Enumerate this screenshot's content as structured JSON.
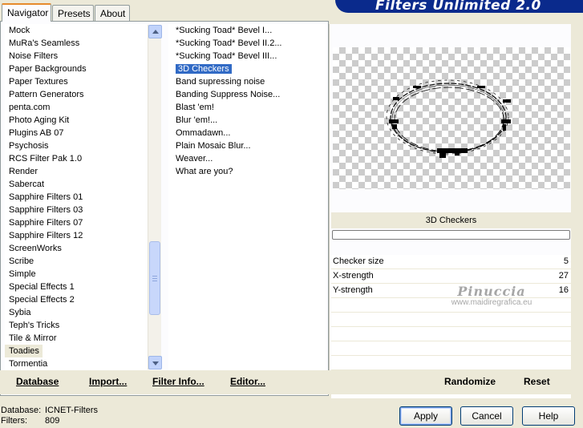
{
  "tabs": [
    "Navigator",
    "Presets",
    "About"
  ],
  "banner_title": "Filters Unlimited 2.0",
  "categories": [
    "Mock",
    "MuRa's Seamless",
    "Noise Filters",
    "Paper Backgrounds",
    "Paper Textures",
    "Pattern Generators",
    "penta.com",
    "Photo Aging Kit",
    "Plugins AB 07",
    "Psychosis",
    "RCS Filter Pak 1.0",
    "Render",
    "Sabercat",
    "Sapphire Filters 01",
    "Sapphire Filters 03",
    "Sapphire Filters 07",
    "Sapphire Filters 12",
    "ScreenWorks",
    "Scribe",
    "Simple",
    "Special Effects 1",
    "Special Effects 2",
    "Sybia",
    "Teph's Tricks",
    "Tile & Mirror",
    "Toadies",
    "Tormentia"
  ],
  "selected_category": "Toadies",
  "filters": [
    "*Sucking Toad*  Bevel I...",
    "*Sucking Toad*  Bevel II.2...",
    "*Sucking Toad*  Bevel III...",
    "3D Checkers",
    "Band supressing noise",
    "Banding Suppress Noise...",
    "Blast 'em!",
    "Blur 'em!...",
    "Ommadawn...",
    "Plain Mosaic Blur...",
    "Weaver...",
    "What are you?"
  ],
  "selected_filter": "3D Checkers",
  "bottom_links": {
    "database": "Database",
    "import": "Import...",
    "filter_info": "Filter Info...",
    "editor": "Editor..."
  },
  "filter_title": "3D Checkers",
  "params": [
    {
      "label": "Checker size",
      "value": "5"
    },
    {
      "label": "X-strength",
      "value": "27"
    },
    {
      "label": "Y-strength",
      "value": "16"
    }
  ],
  "watermark": {
    "name": "Pinuccia",
    "url": "www.maidiregrafica.eu"
  },
  "right_buttons": {
    "randomize": "Randomize",
    "reset": "Reset"
  },
  "status": {
    "database_label": "Database:",
    "database_value": "ICNET-Filters",
    "filters_label": "Filters:",
    "filters_value": "809"
  },
  "buttons": {
    "apply": "Apply",
    "cancel": "Cancel",
    "help": "Help"
  },
  "colors": {
    "selection": "#316ac5",
    "banner": "#0a2a8c",
    "face": "#ece9d8"
  }
}
